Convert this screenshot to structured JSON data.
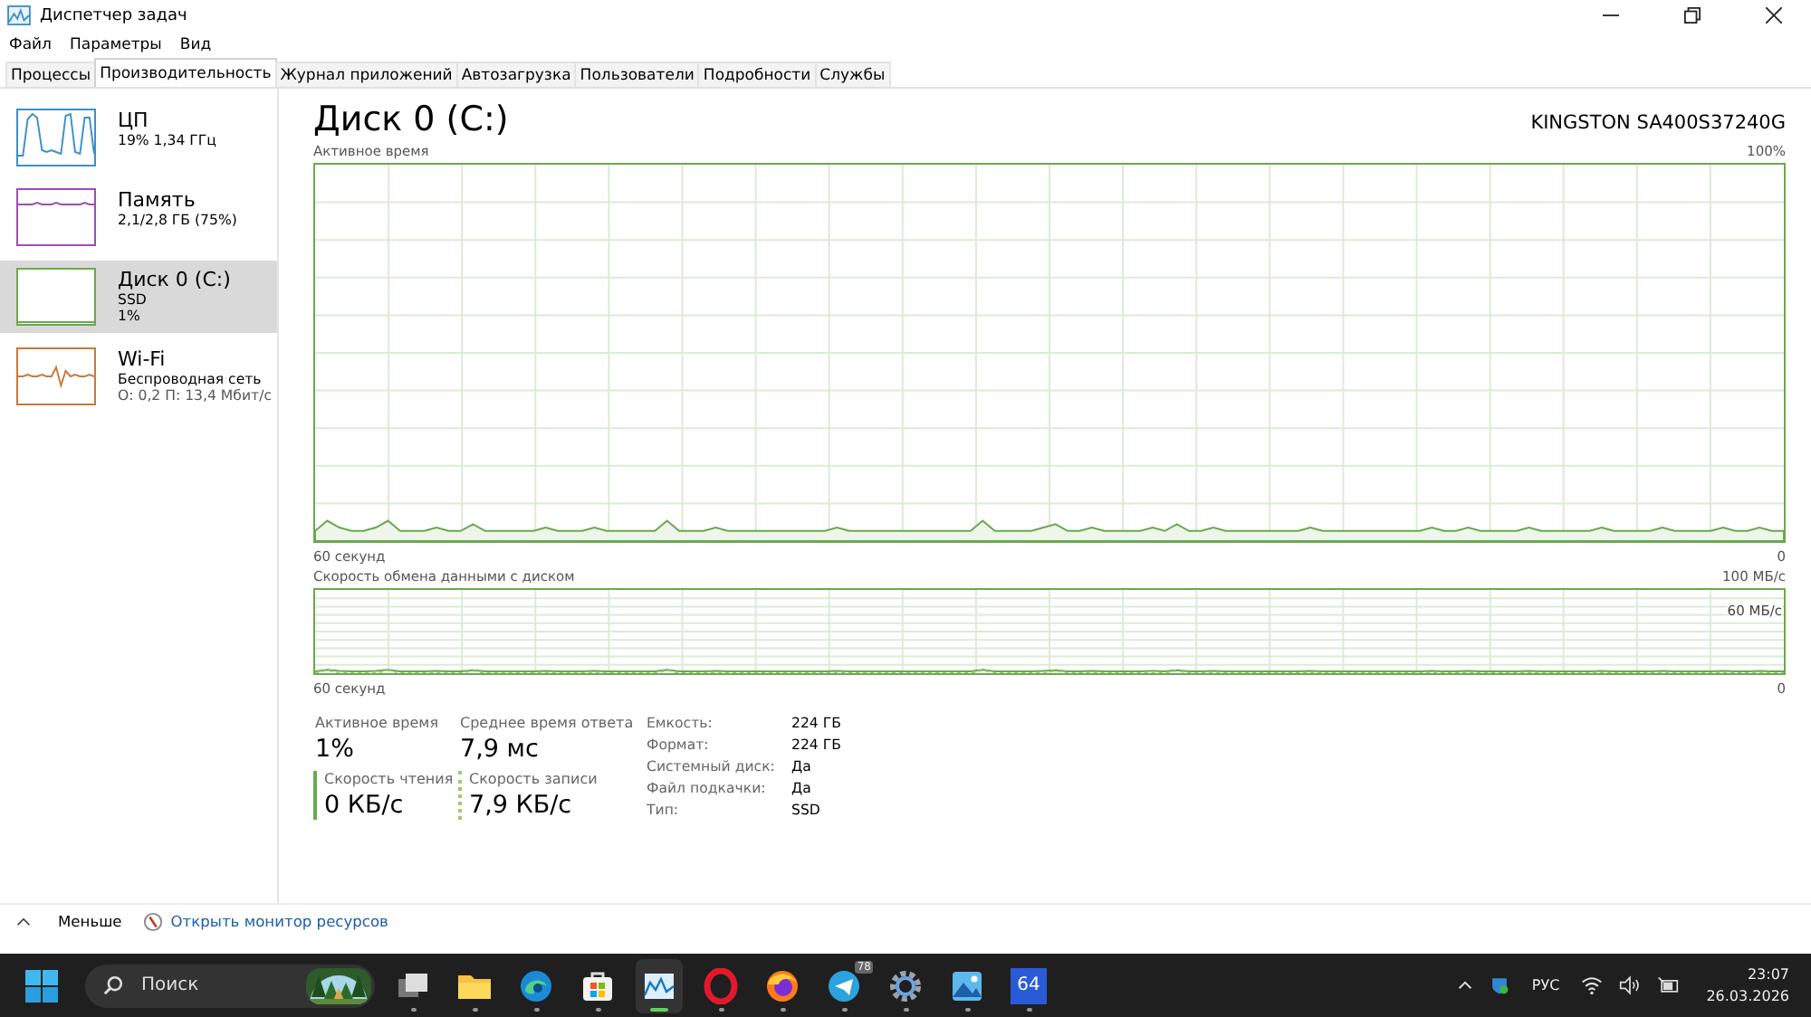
{
  "window": {
    "title": "Диспетчер задач"
  },
  "menu": [
    "Файл",
    "Параметры",
    "Вид"
  ],
  "tabs": [
    {
      "label": "Процессы",
      "selected": false
    },
    {
      "label": "Производительность",
      "selected": true
    },
    {
      "label": "Журнал приложений",
      "selected": false
    },
    {
      "label": "Автозагрузка",
      "selected": false
    },
    {
      "label": "Пользователи",
      "selected": false
    },
    {
      "label": "Подробности",
      "selected": false
    },
    {
      "label": "Службы",
      "selected": false
    }
  ],
  "sidebar": {
    "items": [
      {
        "kind": "cpu",
        "name": "ЦП",
        "lines": [
          "19% 1,34 ГГц"
        ],
        "color": "#3c8fc9",
        "selected": false
      },
      {
        "kind": "memory",
        "name": "Память",
        "lines": [
          "2,1/2,8 ГБ (75%)"
        ],
        "color": "#9b4fb0",
        "selected": false
      },
      {
        "kind": "disk",
        "name": "Диск 0 (C:)",
        "lines": [
          "SSD",
          "1%"
        ],
        "color": "#6aa84f",
        "selected": true
      },
      {
        "kind": "network",
        "name": "Wi-Fi",
        "lines": [
          "Беспроводная сеть",
          "О: 0,2 П: 13,4 Мбит/с"
        ],
        "color": "#c8793c",
        "selected": false
      }
    ]
  },
  "main": {
    "title": "Диск 0 (C:)",
    "model": "KINGSTON SA400S37240G",
    "graphs": [
      {
        "kind": "active",
        "label": "Активное время",
        "max": "100%",
        "time": "60 секунд",
        "min": "0"
      },
      {
        "kind": "transfer",
        "label": "Скорость обмена данными с диском",
        "max": "100 МБ/с",
        "inner": "60 МБ/с",
        "time": "60 секунд",
        "min": "0"
      }
    ],
    "stats": [
      {
        "kind": "plain",
        "label": "Активное время",
        "value": "1%"
      },
      {
        "kind": "plain",
        "label": "Среднее время ответа",
        "value": "7,9 мс"
      },
      {
        "kind": "read",
        "label": "Скорость чтения",
        "value": "0 КБ/с"
      },
      {
        "kind": "write",
        "label": "Скорость записи",
        "value": "7,9 КБ/с"
      }
    ],
    "properties": [
      {
        "label": "Емкость:",
        "value": "224 ГБ"
      },
      {
        "label": "Формат:",
        "value": "224 ГБ"
      },
      {
        "label": "Системный диск:",
        "value": "Да"
      },
      {
        "label": "Файл подкачки:",
        "value": "Да"
      },
      {
        "label": "Тип:",
        "value": "SSD"
      }
    ]
  },
  "footer": {
    "less": "Меньше",
    "monitor_link": "Открыть монитор ресурсов"
  },
  "taskbar": {
    "search_placeholder": "Поиск",
    "apps": [
      {
        "kind": "taskview",
        "active": false
      },
      {
        "kind": "folder",
        "active": false
      },
      {
        "kind": "edge",
        "active": false
      },
      {
        "kind": "store",
        "active": false
      },
      {
        "kind": "taskmgr",
        "active": true
      },
      {
        "kind": "opera",
        "active": false
      },
      {
        "kind": "firefox",
        "active": false
      },
      {
        "kind": "telegram",
        "active": false,
        "badge": "78"
      },
      {
        "kind": "settings",
        "active": false
      },
      {
        "kind": "photos",
        "active": false
      },
      {
        "kind": "aida",
        "active": false,
        "label": "64"
      }
    ],
    "language": "РУС",
    "time": "23:07",
    "date": "26.03.2026"
  }
}
